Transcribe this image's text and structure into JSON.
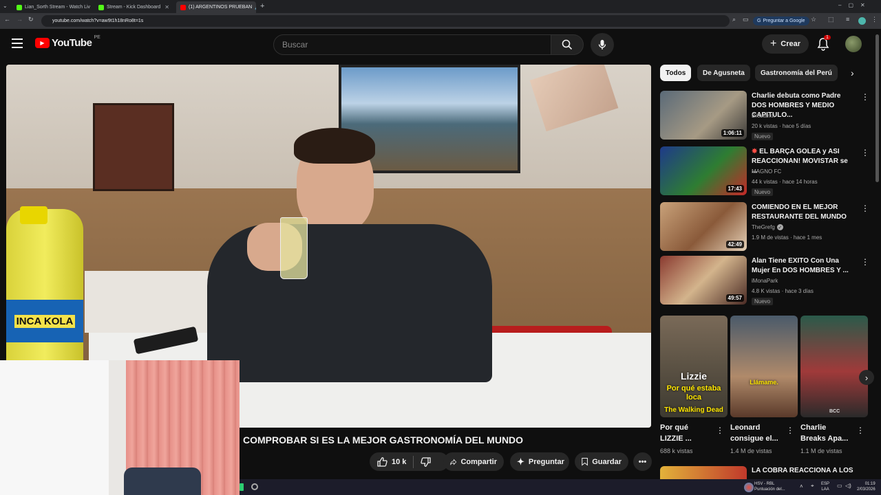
{
  "browser": {
    "tabs": [
      {
        "title": "Lian_Sorth Stream - Watch Liv"
      },
      {
        "title": "Stream - Kick Dashboard"
      },
      {
        "title": "(1) ARGENTINOS PRUEBAN"
      }
    ],
    "url": "youtube.com/watch?v=aw9t1h18nRo8t=1s",
    "ask_google": "Preguntar a Google"
  },
  "youtube": {
    "logo_text": "YouTube",
    "country": "PE",
    "search_placeholder": "Buscar",
    "create_label": "Crear",
    "notification_count": "1"
  },
  "video": {
    "title": "COMPROBAR SI ES LA MEJOR GASTRONOMÍA DEL MUNDO",
    "likes": "10 k",
    "share_label": "Compartir",
    "ask_label": "Preguntar",
    "save_label": "Guardar",
    "bottle_text": "INCA KOLA"
  },
  "sidebar": {
    "chips": [
      "Todos",
      "De Agusneta",
      "Gastronomía del Perú"
    ],
    "recs": [
      {
        "title": "Charlie debuta como Padre DOS HOMBRES Y MEDIO CAPITULO...",
        "channel": "Brostarkk",
        "meta": "20 k vistas · hace 5 días",
        "badge": "Nuevo",
        "duration": "1:06:11"
      },
      {
        "title": "EL BARÇA GOLEA y ASI REACCIONAN! MOVISTAR se ...",
        "channel": "MAGNO FC",
        "meta": "44 k vistas · hace 14 horas",
        "badge": "Nuevo",
        "duration": "17:43"
      },
      {
        "title": "COMIENDO EN EL MEJOR RESTAURANTE DEL MUNDO",
        "channel": "TheGrefg",
        "meta": "1.9 M de vistas · hace 1 mes",
        "badge": "",
        "duration": "42:49"
      },
      {
        "title": "Alan Tiene EXITO Con Una Mujer En DOS HOMBRES Y ...",
        "channel": "iMonaPark",
        "meta": "4.8 K vistas · hace 3 días",
        "badge": "Nuevo",
        "duration": "49:57"
      }
    ],
    "shorts": [
      {
        "title_l1": "Por qué",
        "title_l2": "LIZZIE ...",
        "views": "688 k vistas",
        "overlay1": "Lizzie",
        "overlay2": "Por qué estaba loca",
        "overlay3": "The Walking Dead"
      },
      {
        "title_l1": "Leonard",
        "title_l2": "consigue el...",
        "views": "1.4 M de vistas",
        "overlay1": "Llámame."
      },
      {
        "title_l1": "Charlie",
        "title_l2": "Breaks Apa...",
        "views": "1.1 M de vistas",
        "overlay1": "BCC"
      }
    ],
    "next_rec_title": "LA COBRA REACCIONA A LOS"
  },
  "taskbar": {
    "match": "HSV - RBL",
    "match_sub": "Puntuación del...",
    "lang": "ESP",
    "lang_sub": "LAA",
    "time": "01:19",
    "date": "2/03/2026"
  }
}
